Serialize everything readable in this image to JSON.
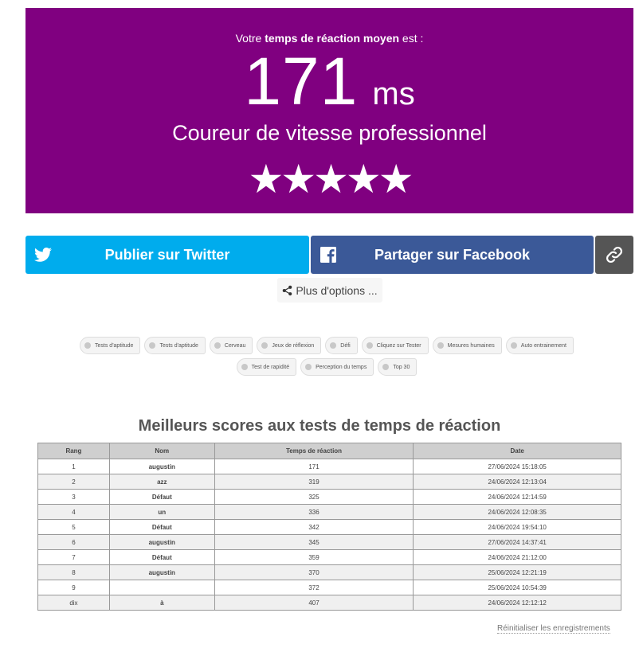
{
  "result": {
    "intro_prefix": "Votre ",
    "intro_bold": "temps de réaction moyen",
    "intro_suffix": " est :",
    "score": "171",
    "unit": "ms",
    "rank_label": "Coureur de vitesse professionnel",
    "stars": "★★★★★",
    "stars_rating": 5,
    "stars_max": 5,
    "background_color": "#800080"
  },
  "share": {
    "twitter_label": "Publier sur Twitter",
    "facebook_label": "Partager sur Facebook",
    "more_label": "Plus d'options ...",
    "twitter_color": "#00aced",
    "facebook_color": "#3b5998",
    "link_color": "#555555",
    "icons": [
      "twitter-icon",
      "facebook-icon",
      "link-icon",
      "share-icon"
    ]
  },
  "tags": [
    "Tests d'aptitude",
    "Tests d'aptitude",
    "Cerveau",
    "Jeux de réflexion",
    "Défi",
    "Cliquez sur Tester",
    "Mesures humaines",
    "Auto entrainement",
    "Test de rapidité",
    "Perception du temps",
    "Top 30"
  ],
  "leaderboard": {
    "title": "Meilleurs scores aux tests de temps de réaction",
    "columns": [
      "Rang",
      "Nom",
      "Temps de réaction",
      "Date"
    ],
    "rows": [
      [
        "1",
        "augustin",
        "171",
        "27/06/2024 15:18:05"
      ],
      [
        "2",
        "azz",
        "319",
        "24/06/2024 12:13:04"
      ],
      [
        "3",
        "Défaut",
        "325",
        "24/06/2024 12:14:59"
      ],
      [
        "4",
        "un",
        "336",
        "24/06/2024 12:08:35"
      ],
      [
        "5",
        "Défaut",
        "342",
        "24/06/2024 19:54:10"
      ],
      [
        "6",
        "augustin",
        "345",
        "27/06/2024 14:37:41"
      ],
      [
        "7",
        "Défaut",
        "359",
        "24/06/2024 21:12:00"
      ],
      [
        "8",
        "augustin",
        "370",
        "25/06/2024 12:21:19"
      ],
      [
        "9",
        "",
        "372",
        "25/06/2024 10:54:39"
      ],
      [
        "dix",
        "à",
        "407",
        "24/06/2024 12:12:12"
      ]
    ],
    "reset_label": "Réinitialiser les enregistrements"
  }
}
